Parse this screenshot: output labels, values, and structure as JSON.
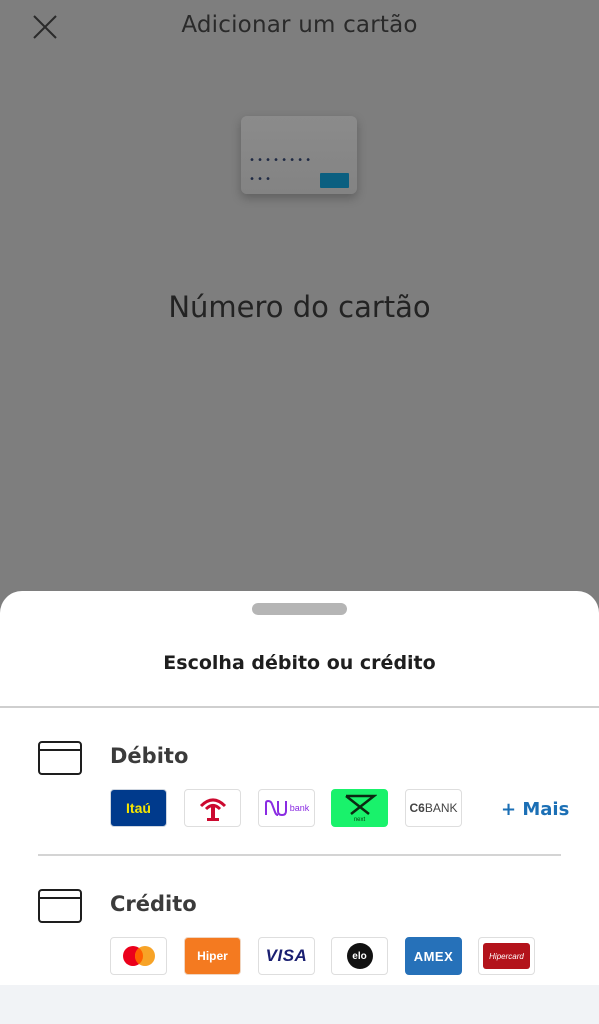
{
  "header": {
    "title": "Adicionar um cartão",
    "close_icon": "close-icon"
  },
  "card_illustration": {
    "dots_row1": "••••••••",
    "dots_row2": "•••",
    "chip_color": "#0b5f80"
  },
  "field": {
    "label": "Número do cartão"
  },
  "sheet": {
    "title": "Escolha débito ou crédito",
    "debit": {
      "label": "Débito",
      "icon": "card-outline-icon",
      "more_label": "+ Mais",
      "logos": [
        {
          "name": "itau",
          "text": "Itaú",
          "bg": "#003a8c"
        },
        {
          "name": "bradesco",
          "text": "",
          "bg": "#ffffff"
        },
        {
          "name": "nubank",
          "text": "bank",
          "bg": "#ffffff"
        },
        {
          "name": "next",
          "text": "next",
          "bg": "#19f26b"
        },
        {
          "name": "c6-bank",
          "text_bold": "C6",
          "text": "BANK",
          "bg": "#ffffff"
        }
      ]
    },
    "credit": {
      "label": "Crédito",
      "icon": "card-outline-icon",
      "logos": [
        {
          "name": "mastercard",
          "text": "",
          "bg": "#ffffff"
        },
        {
          "name": "hiper",
          "text": "Hiper",
          "bg": "#f47a20"
        },
        {
          "name": "visa",
          "text": "VISA",
          "bg": "#ffffff"
        },
        {
          "name": "elo",
          "text": "elo",
          "bg": "#ffffff"
        },
        {
          "name": "amex",
          "text": "AMEX",
          "bg": "#2671b9"
        },
        {
          "name": "hipercard",
          "text": "Hipercard",
          "bg": "#b3131b"
        }
      ]
    }
  },
  "colors": {
    "overlay": "#7e7e7e",
    "accent_link": "#1b6fb5",
    "sheet_bg": "#ffffff"
  }
}
